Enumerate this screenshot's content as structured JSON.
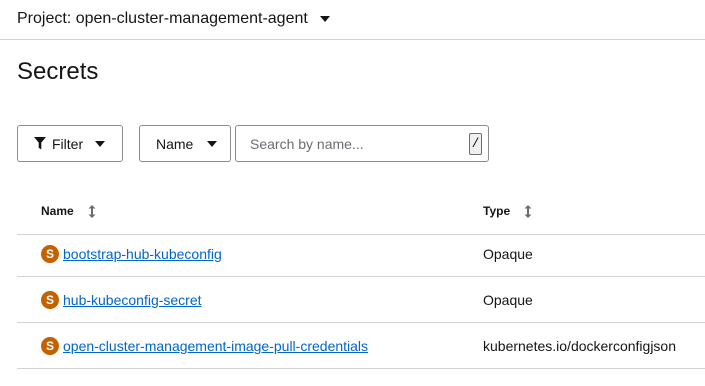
{
  "project": {
    "label": "Project: open-cluster-management-agent",
    "icon": "chevron-down-icon"
  },
  "page": {
    "title": "Secrets"
  },
  "toolbar": {
    "filter_label": "Filter",
    "name_label": "Name",
    "search_placeholder": "Search by name...",
    "search_value": "",
    "shortcut_hint": "/"
  },
  "table": {
    "columns": [
      {
        "label": "Name",
        "icon": "sort-icon"
      },
      {
        "label": "Type",
        "icon": "sort-icon"
      }
    ],
    "rows": [
      {
        "badge": "S",
        "name": "bootstrap-hub-kubeconfig",
        "type": "Opaque"
      },
      {
        "badge": "S",
        "name": "hub-kubeconfig-secret",
        "type": "Opaque"
      },
      {
        "badge": "S",
        "name": "open-cluster-management-image-pull-credentials",
        "type": "kubernetes.io/dockerconfigjson"
      }
    ]
  },
  "colors": {
    "link": "#0066cc",
    "badge": "#c46100",
    "border": "#d2d2d2",
    "text": "#151515"
  }
}
